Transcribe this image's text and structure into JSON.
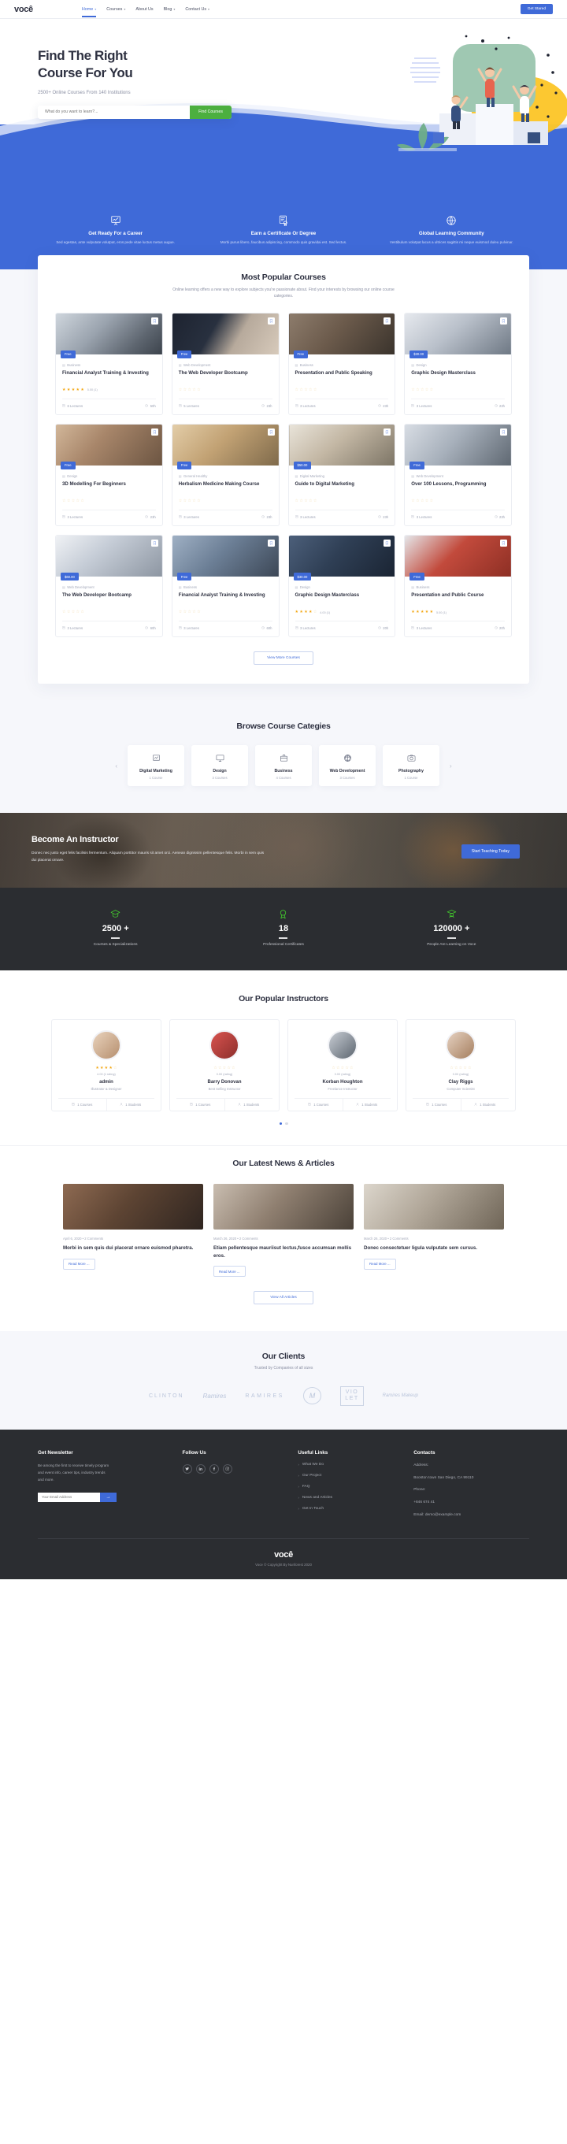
{
  "brand": {
    "name": "você",
    "footer_copyright": "Voce © Copyright By Nunforest 2020"
  },
  "header": {
    "nav": [
      {
        "label": "Home",
        "caret": true,
        "active": true
      },
      {
        "label": "Courses",
        "caret": true,
        "active": false
      },
      {
        "label": "About Us",
        "caret": false,
        "active": false
      },
      {
        "label": "Blog",
        "caret": true,
        "active": false
      },
      {
        "label": "Contact Us",
        "caret": true,
        "active": false
      }
    ],
    "cta": "Get Stared"
  },
  "hero": {
    "title_line1": "Find The Right",
    "title_line2": "Course For You",
    "subtitle": "2500+ Online Courses From 140 Institutions",
    "search_placeholder": "What do you want to learn?...",
    "search_value": "",
    "search_button": "Find Courses"
  },
  "features": [
    {
      "icon": "presentation-chart-icon",
      "title": "Get Ready For a Career",
      "desc": "Sed egestas, ante vulputate volutpat, eros pede vitae luctus metus augue."
    },
    {
      "icon": "certificate-icon",
      "title": "Earn a Certificate Or Degree",
      "desc": "Morbi purus libero, faucibus adipiscing, commodo quis gravidai est. Sed lectus."
    },
    {
      "icon": "globe-icon",
      "title": "Global Learning Community",
      "desc": "Vestibulum volutpat lacus a ultrices sagittis mi neque euismod duleu pulvinar."
    }
  ],
  "courses": {
    "title": "Most Popular Courses",
    "subtitle": "Online learning offers a new way to explore subjects you're passionate about. Find your interests by browsing our online course categories.",
    "more_button": "View More Courses",
    "items": [
      {
        "badge": "Free",
        "category": "Business",
        "title": "Financial Analyst Training & Investing",
        "stars": 5,
        "rating": "5.00 (1)",
        "lectures": "6 Lectures",
        "duration": "50h",
        "img": "laptop-desk"
      },
      {
        "badge": "Free",
        "category": "Web Development",
        "title": "The Web Developer Bootcamp",
        "stars": 0,
        "rating": "",
        "lectures": "5 Lectures",
        "duration": "23h",
        "img": "code-coffee"
      },
      {
        "badge": "Free",
        "category": "Business",
        "title": "Presentation and Public Speaking",
        "stars": 0,
        "rating": "",
        "lectures": "3 Lectures",
        "duration": "23h",
        "img": "speaker-stage"
      },
      {
        "badge": "$30.00",
        "category": "Design",
        "title": "Graphic Design Masterclass",
        "stars": 0,
        "rating": "",
        "lectures": "3 Lectures",
        "duration": "23h",
        "img": "imac-desk"
      },
      {
        "badge": "Free",
        "category": "Design",
        "title": "3D Modelling For Beginners",
        "stars": 0,
        "rating": "",
        "lectures": "3 Lectures",
        "duration": "23h",
        "img": "design-table"
      },
      {
        "badge": "Free",
        "category": "General Healthy",
        "title": "Herbalism Medicine Making Course",
        "stars": 0,
        "rating": "",
        "lectures": "3 Lectures",
        "duration": "23h",
        "img": "herbs-jars"
      },
      {
        "badge": "$50.00",
        "category": "Digital Marketing",
        "title": "Guide to Digital Marketing",
        "stars": 0,
        "rating": "",
        "lectures": "3 Lectures",
        "duration": "23h",
        "img": "room-interior"
      },
      {
        "badge": "Free",
        "category": "Web Development",
        "title": "Over 100 Lessons, Programming",
        "stars": 0,
        "rating": "",
        "lectures": "3 Lectures",
        "duration": "23h",
        "img": "tablet-hands"
      },
      {
        "badge": "$60.00",
        "category": "Web Development",
        "title": "The Web Developer Bootcamp",
        "stars": 0,
        "rating": "",
        "lectures": "3 Lectures",
        "duration": "60h",
        "img": "charts-paper"
      },
      {
        "badge": "Free",
        "category": "Business",
        "title": "Financial Analyst Training & Investing",
        "stars": 0,
        "rating": "",
        "lectures": "3 Lectures",
        "duration": "60h",
        "img": "man-desk"
      },
      {
        "badge": "$30.00",
        "category": "Design",
        "title": "Graphic Design Masterclass",
        "stars": 4,
        "rating": "4.00 (1)",
        "lectures": "3 Lectures",
        "duration": "20h",
        "img": "designer-hands"
      },
      {
        "badge": "Free",
        "category": "Business",
        "title": "Presentation and Public Course",
        "stars": 5,
        "rating": "5.00 (1)",
        "lectures": "3 Lectures",
        "duration": "20h",
        "img": "red-books"
      }
    ]
  },
  "categories": {
    "title": "Browse Course Categies",
    "items": [
      {
        "icon": "chart-board-icon",
        "name": "Digital Marketing",
        "count": "1 Course"
      },
      {
        "icon": "monitor-icon",
        "name": "Design",
        "count": "3 Courses"
      },
      {
        "icon": "briefcase-icon",
        "name": "Business",
        "count": "4 Courses"
      },
      {
        "icon": "network-icon",
        "name": "Web Development",
        "count": "3 Courses"
      },
      {
        "icon": "camera-icon",
        "name": "Photography",
        "count": "1 Course"
      }
    ]
  },
  "instructor": {
    "title": "Become An Instructor",
    "desc": "Donec nec justo eget felis facilisis fermentum. Aliquam porttitor mauris sit amet orci. Aenean dignissim pellentesque felis. Morbi in sem quis dui placerat ornare.",
    "cta": "Start Teaching Today"
  },
  "stats": [
    {
      "icon": "graduation-cap-icon",
      "number": "2500 +",
      "label": "Courses & Specializations"
    },
    {
      "icon": "award-icon",
      "number": "18",
      "label": "Professional Certificates"
    },
    {
      "icon": "student-icon",
      "number": "120000 +",
      "label": "People Are Learning on Voce"
    }
  ],
  "instructors": {
    "title": "Our Popular Instructors",
    "items": [
      {
        "name": "admin",
        "role": "Illustrator & Designer",
        "stars": 4,
        "rating": "4.00 (1 rating)",
        "courses": "1 Courses",
        "students": "1 Students"
      },
      {
        "name": "Barry Donovan",
        "role": "Best Selling Instructor",
        "stars": 0,
        "rating": "0.00 (rating)",
        "courses": "1 Courses",
        "students": "1 Students"
      },
      {
        "name": "Korban Houghton",
        "role": "Freelance Instructor",
        "stars": 0,
        "rating": "0.00 (rating)",
        "courses": "1 Courses",
        "students": "1 Students"
      },
      {
        "name": "Clay Riggs",
        "role": "Computer Scientist",
        "stars": 0,
        "rating": "0.00 (rating)",
        "courses": "1 Courses",
        "students": "1 Students"
      }
    ]
  },
  "news": {
    "title": "Our Latest News & Articles",
    "view_all": "View All Articles",
    "read_more": "Read More ...",
    "posts": [
      {
        "meta": "April 6, 2020  •  2 Comments",
        "title": "Morbi in sem quis dui placerat ornare euismod pharetra.",
        "img": "woman-laptop"
      },
      {
        "meta": "March 26, 2020  •  2 Comments",
        "title": "Etiam pellentesque mauriisut lectus,fusce accumsan mollis eros.",
        "img": "student-study"
      },
      {
        "meta": "March 26, 2020  •  2 Comments",
        "title": "Donec consectetuer ligula vulputate sem cursus.",
        "img": "hands-writing"
      }
    ]
  },
  "clients": {
    "title": "Our Clients",
    "subtitle": "Trusted by Companies of all sizes",
    "logos": [
      "CLINTON",
      "Ramires",
      "RAMIRES",
      "M",
      "VIOLET",
      "Ramires Makeup"
    ]
  },
  "footer": {
    "newsletter": {
      "title": "Get Newsletter",
      "desc": "Be among the first to receive timely program and event info, career tips, industry trends and more.",
      "placeholder": "Your Email Address",
      "value": ""
    },
    "follow": {
      "title": "Follow Us",
      "socials": [
        "twitter-icon",
        "linkedin-icon",
        "facebook-icon",
        "instagram-icon"
      ]
    },
    "links": {
      "title": "Useful Links",
      "items": [
        "What We Do",
        "Our Project",
        "FAQ",
        "News and Articles",
        "Get In Touch"
      ]
    },
    "contacts": {
      "title": "Contacts",
      "address_label": "Address:",
      "address": "Booston town San Diego, CA 99110",
      "phone_label": "Phone:",
      "phone": "+846 674 41",
      "email_label": "Email:",
      "email": "demo@example.com"
    }
  },
  "colors": {
    "primary": "#3f6ad8",
    "green": "#4caf3f",
    "dark": "#2b2d31",
    "star": "#f3a712",
    "accent_green": "#44d62c"
  }
}
